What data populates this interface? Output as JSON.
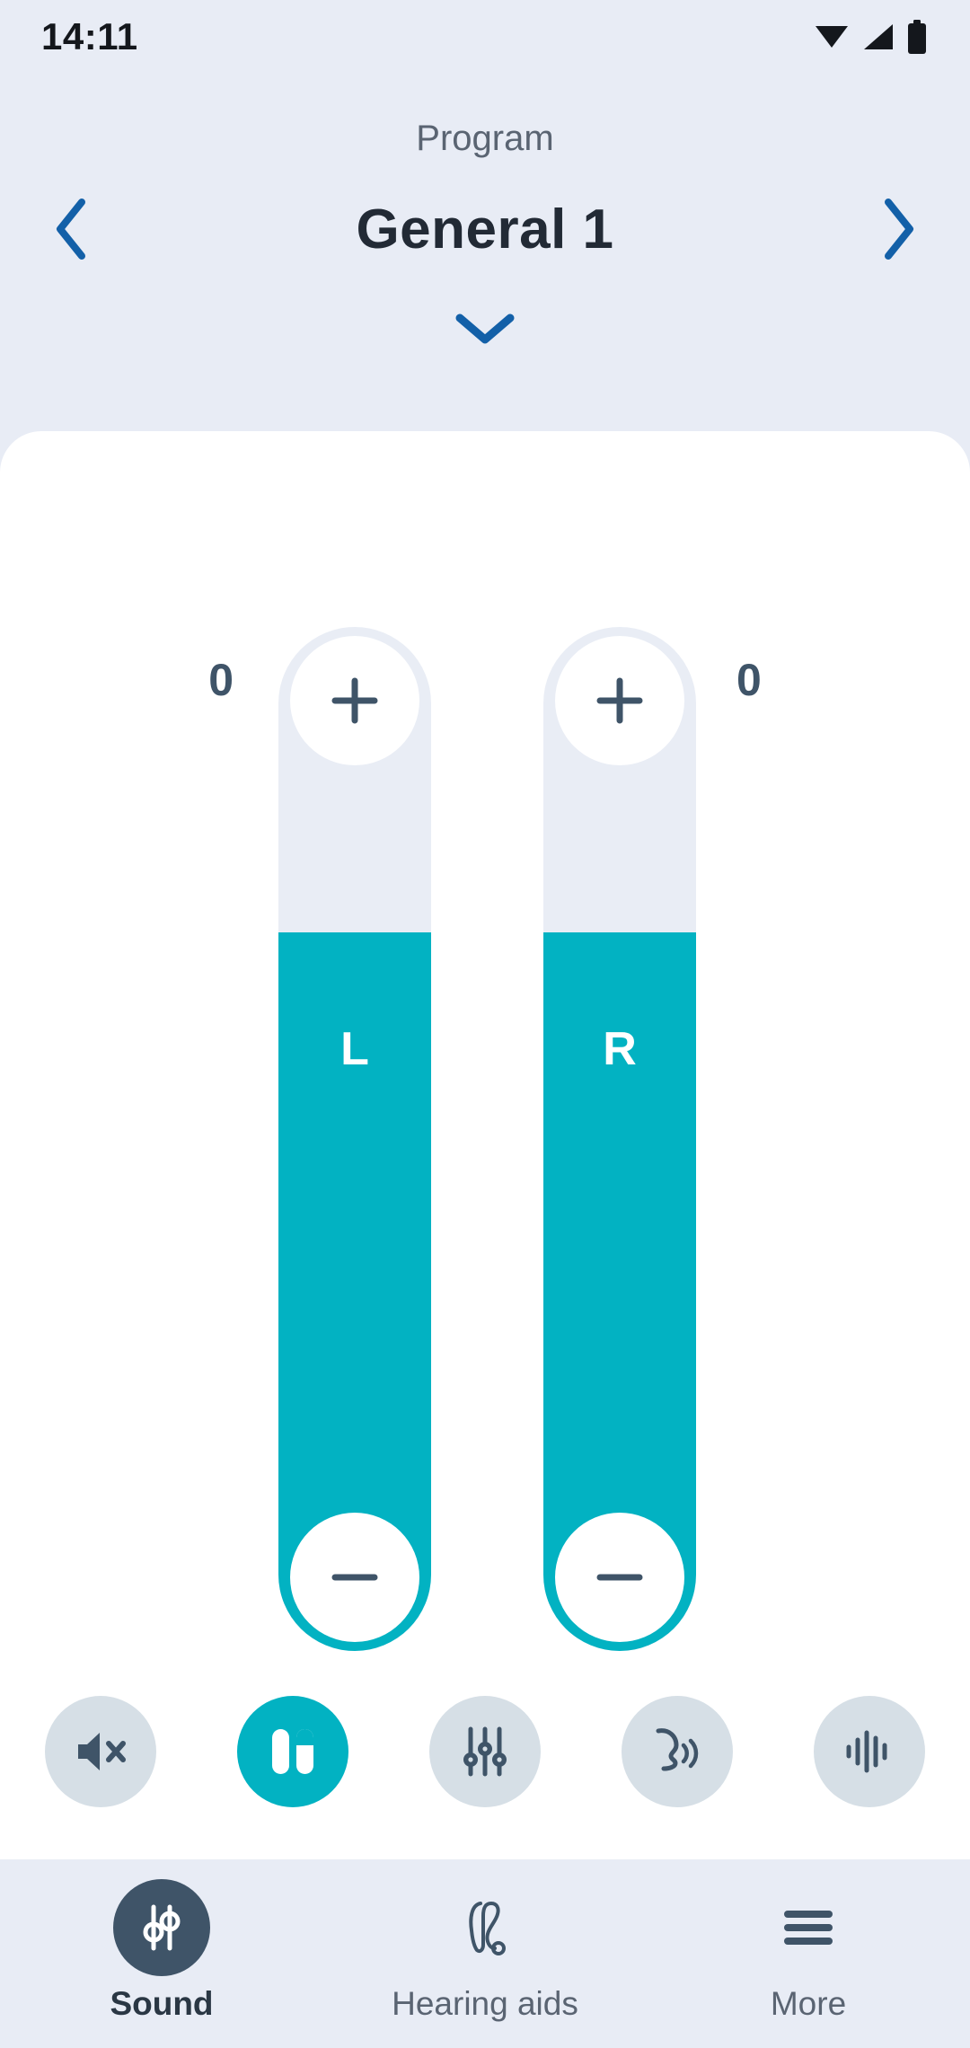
{
  "status_bar": {
    "time": "14:11",
    "icons": [
      "wifi-icon",
      "cellular-signal-icon",
      "battery-icon"
    ]
  },
  "header": {
    "program_label": "Program",
    "program_name": "General 1",
    "prev_icon": "chevron-left-icon",
    "next_icon": "chevron-right-icon",
    "dropdown_icon": "chevron-down-icon",
    "accent_blue": "#1360A8"
  },
  "volume": {
    "left": {
      "ear": "L",
      "value": "0"
    },
    "right": {
      "ear": "R",
      "value": "0"
    },
    "increase_icon": "plus-icon",
    "decrease_icon": "minus-icon",
    "fill_color": "#02B2C2",
    "track_color": "#E9EDF5"
  },
  "actions": [
    {
      "name": "mute",
      "icon": "speaker-mute-icon",
      "active": false
    },
    {
      "name": "balance",
      "icon": "balance-bars-icon",
      "active": true
    },
    {
      "name": "equalizer",
      "icon": "equalizer-icon",
      "active": false
    },
    {
      "name": "speech-focus",
      "icon": "speech-focus-icon",
      "active": false
    },
    {
      "name": "noise",
      "icon": "sound-wave-icon",
      "active": false
    }
  ],
  "bottom_nav": [
    {
      "label": "Sound",
      "icon": "sound-sliders-icon",
      "active": true
    },
    {
      "label": "Hearing aids",
      "icon": "hearing-aid-icon",
      "active": false
    },
    {
      "label": "More",
      "icon": "hamburger-menu-icon",
      "active": false
    }
  ]
}
